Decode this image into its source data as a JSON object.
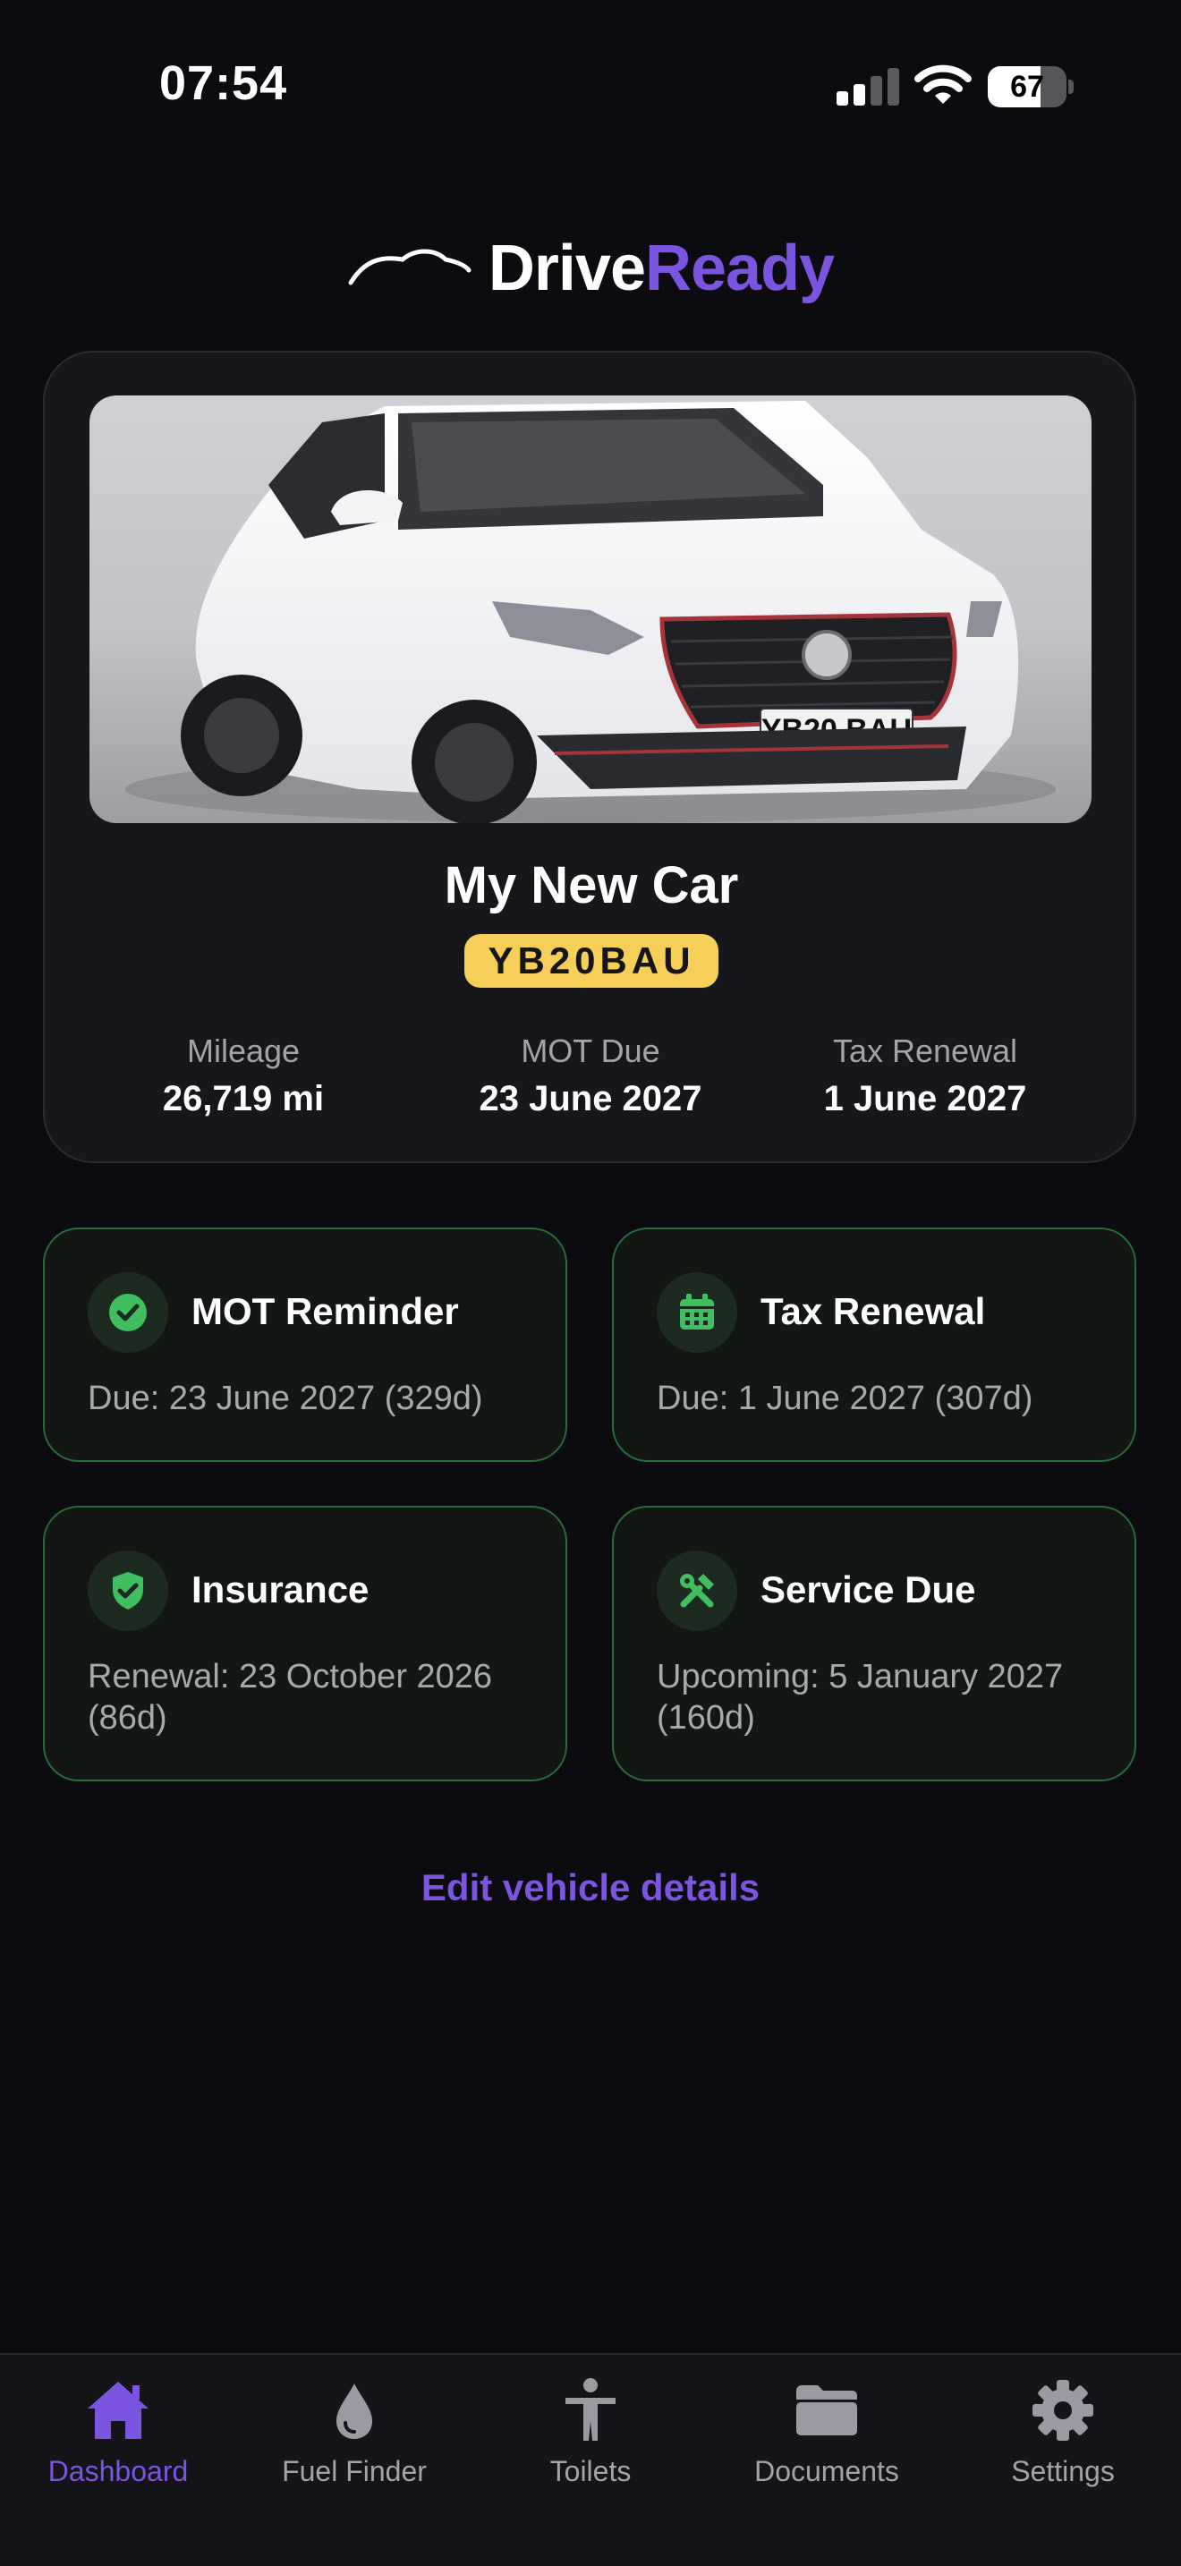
{
  "status_bar": {
    "time": "07:54",
    "battery_percent": 67
  },
  "app": {
    "name_part1": "Drive",
    "name_part2": "Ready",
    "accent_color": "#7b55e0"
  },
  "vehicle": {
    "name": "My New Car",
    "registration": "YB20BAU",
    "photo_plate_text": "YB20 BAU",
    "stats": [
      {
        "label": "Mileage",
        "value": "26,719 mi"
      },
      {
        "label": "MOT Due",
        "value": "23 June 2027"
      },
      {
        "label": "Tax Renewal",
        "value": "1 June 2027"
      }
    ]
  },
  "reminders": [
    {
      "title": "MOT Reminder",
      "description": "Due: 23 June 2027 (329d)",
      "icon": "check-circle-icon"
    },
    {
      "title": "Tax Renewal",
      "description": "Due: 1 June 2027 (307d)",
      "icon": "calendar-icon"
    },
    {
      "title": "Insurance",
      "description": "Renewal: 23 October 2026 (86d)",
      "icon": "shield-check-icon"
    },
    {
      "title": "Service Due",
      "description": "Upcoming: 5 January 2027 (160d)",
      "icon": "tools-icon"
    }
  ],
  "edit_link": "Edit vehicle details",
  "tabs": [
    {
      "label": "Dashboard",
      "icon": "home-icon",
      "active": true
    },
    {
      "label": "Fuel Finder",
      "icon": "fuel-drop-icon",
      "active": false
    },
    {
      "label": "Toilets",
      "icon": "person-icon",
      "active": false
    },
    {
      "label": "Documents",
      "icon": "folder-icon",
      "active": false
    },
    {
      "label": "Settings",
      "icon": "gear-icon",
      "active": false
    }
  ],
  "colors": {
    "background": "#0b0b10",
    "card": "#16161b",
    "reminder_border": "#2b6b3b",
    "reminder_icon": "#3fbf5f",
    "plate_yellow": "#f5cf58"
  }
}
